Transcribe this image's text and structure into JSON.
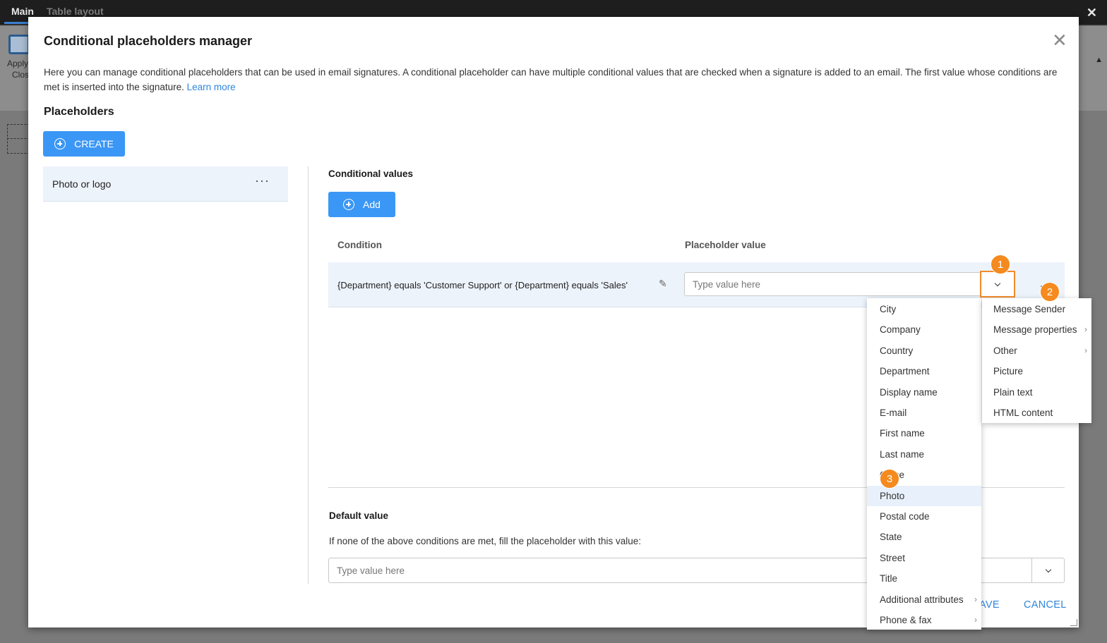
{
  "app": {
    "tabs": [
      "Main",
      "Table layout"
    ],
    "close_glyph": "✕",
    "ribbon": {
      "apply_label": "Apply",
      "close_label": "Clos"
    }
  },
  "dialog": {
    "title": "Conditional placeholders manager",
    "close_glyph": "✕",
    "description": "Here you can manage conditional placeholders that can be used in email signatures. A conditional placeholder can have multiple conditional values that are checked when a signature is added to an email. The first value whose conditions are met is inserted into the signature.",
    "learn_more": "Learn more",
    "placeholders_title": "Placeholders",
    "create_label": "CREATE",
    "placeholders": [
      {
        "label": "Photo or logo",
        "more": "···"
      }
    ],
    "conditional_values_title": "Conditional values",
    "add_label": "Add",
    "columns": {
      "condition": "Condition",
      "value": "Placeholder value"
    },
    "rows": [
      {
        "condition": "{Department} equals 'Customer Support' or {Department} equals 'Sales'",
        "value_placeholder": "Type value here"
      }
    ],
    "default_value_title": "Default value",
    "default_value_desc": "If none of the above conditions are met, fill the placeholder with this value:",
    "default_value_placeholder": "Type value here",
    "save_label": "AVE",
    "cancel_label": "CANCEL"
  },
  "menus": {
    "attributes": [
      "City",
      "Company",
      "Country",
      "Department",
      "Display name",
      "E-mail",
      "First name",
      "Last name",
      "Office",
      "Photo",
      "Postal code",
      "State",
      "Street",
      "Title",
      "Additional attributes",
      "Phone & fax"
    ],
    "attributes_selected": "Photo",
    "attributes_with_submenu": [
      "Additional attributes",
      "Phone & fax"
    ],
    "categories": [
      "Message Sender",
      "Message properties",
      "Other",
      "Picture",
      "Plain text",
      "HTML content"
    ],
    "categories_with_submenu": [
      "Message properties",
      "Other"
    ]
  },
  "badges": [
    "1",
    "2",
    "3"
  ],
  "colors": {
    "accent": "#3b97f5",
    "link": "#2e86de",
    "highlight_border": "#f28c28",
    "badge": "#f58a1f",
    "selected_row": "#edf3fb"
  }
}
